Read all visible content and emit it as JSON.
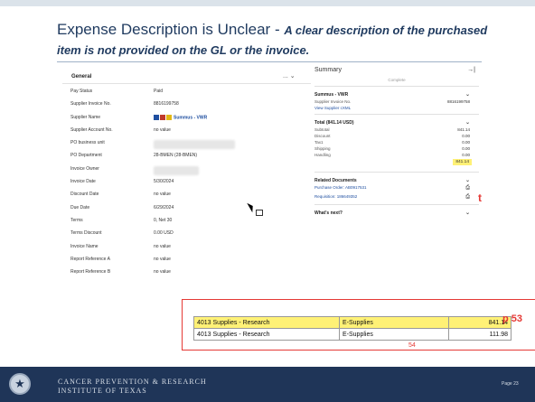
{
  "slide": {
    "title": "Expense Description is Unclear - ",
    "subtitle": "A clear description of the purchased item is not provided on the GL or the invoice.",
    "page": "Page 23"
  },
  "general": {
    "title": "General",
    "menu": "... ⌄",
    "rows": [
      {
        "label": "Pay Status",
        "value": "Paid"
      },
      {
        "label": "Supplier Invoice No.",
        "value": "8816199758"
      },
      {
        "label": "Supplier Name",
        "value": "Summus - VWR"
      },
      {
        "label": "Supplier Account No.",
        "value": "no value"
      },
      {
        "label": "PO business unit",
        "value": ""
      },
      {
        "label": "PO Department",
        "value": "28-BMEN (28-BMEN)"
      },
      {
        "label": "Invoice Owner",
        "value": ""
      },
      {
        "label": "Invoice Date",
        "value": "5/30/2024"
      },
      {
        "label": "Discount Date",
        "value": "no value"
      },
      {
        "label": "Due Date",
        "value": "6/29/2024"
      },
      {
        "label": "Terms",
        "value": "0, Net 30"
      },
      {
        "label": "Terms Discount",
        "value": "0.00 USD"
      },
      {
        "label": "Invoice Name",
        "value": "no value"
      },
      {
        "label": "Report Reference A",
        "value": "no value"
      },
      {
        "label": "Report Reference B",
        "value": "no value"
      }
    ]
  },
  "summary": {
    "title": "Summary",
    "pin": "→|",
    "status": "Complete",
    "supplier_title": "Summus - VWR",
    "invoice_label": "Supplier Invoice No.",
    "invoice_value": "8816199758",
    "view_link": "View Supplier cXML",
    "total_title": "Total (841.14 USD)",
    "lines": [
      {
        "label": "Subtotal",
        "value": "841.14"
      },
      {
        "label": "Discount",
        "value": "0.00"
      },
      {
        "label": "Tax1",
        "value": "0.00"
      },
      {
        "label": "Shipping",
        "value": "0.00"
      },
      {
        "label": "Handling",
        "value": "0.00"
      }
    ],
    "total": "841.14",
    "related_title": "Related Documents",
    "po_link": "Purchase Order: AB0917531",
    "req_link": "Requisition: 186649352",
    "next_title": "What's next?"
  },
  "gl_table": {
    "rows": [
      {
        "desc": "4013 Supplies - Research",
        "cat": "E-Supplies",
        "amount": "841.14"
      },
      {
        "desc": "4013 Supplies - Research",
        "cat": "E-Supplies",
        "amount": "111.98"
      }
    ]
  },
  "annotations": {
    "t": "t",
    "p53": "p 53",
    "p54": "54"
  },
  "footer": {
    "line1": "CANCER PREVENTION & RESEARCH",
    "line2": "INSTITUTE OF TEXAS"
  },
  "colors": {
    "title": "#1f3a5f",
    "highlight": "#fff176",
    "red": "#e53935",
    "footer": "#1f3558"
  }
}
